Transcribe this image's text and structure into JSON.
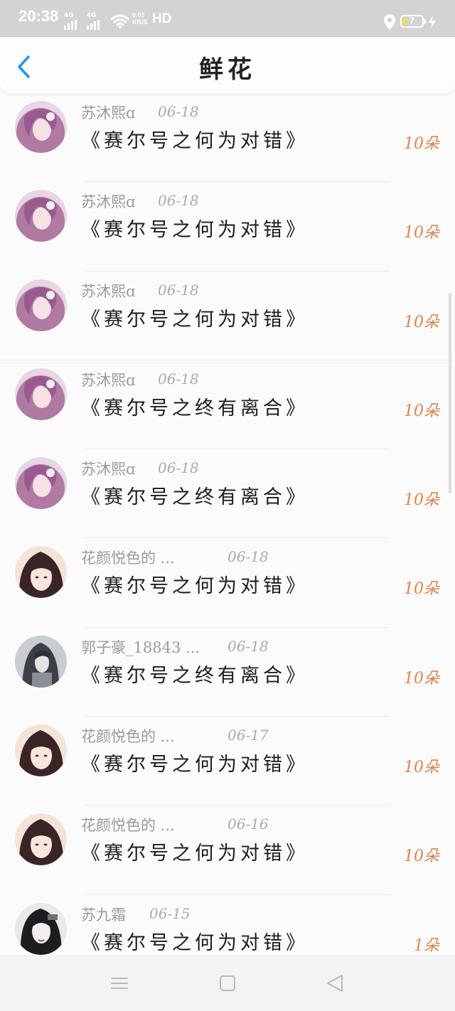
{
  "status_bar": {
    "time": "20:38",
    "network_labels": [
      "4G",
      "4G"
    ],
    "net_speed_value": "0.03",
    "net_speed_unit": "KB/S",
    "hd_label": "HD",
    "battery_level": "7",
    "battery_fill_fraction": 0.07,
    "icons": [
      "signal-icon",
      "signal-icon",
      "wifi-icon",
      "location-icon",
      "battery-icon",
      "charging-icon"
    ]
  },
  "header": {
    "title": "鲜花",
    "back_icon": "chevron-left-icon"
  },
  "colors": {
    "accent_blue": "#2196e8",
    "count_orange": "#e2834b",
    "status_bar_bg": "#d3d3d5"
  },
  "gifts": [
    {
      "user": "苏沐熙ɑ",
      "date": "06-18",
      "work": "《赛尔号之何为对错》",
      "count": "10朵",
      "avatar": "pink-hair-girl"
    },
    {
      "user": "苏沐熙ɑ",
      "date": "06-18",
      "work": "《赛尔号之何为对错》",
      "count": "10朵",
      "avatar": "pink-hair-girl"
    },
    {
      "user": "苏沐熙ɑ",
      "date": "06-18",
      "work": "《赛尔号之何为对错》",
      "count": "10朵",
      "avatar": "pink-hair-girl"
    },
    {
      "user": "苏沐熙ɑ",
      "date": "06-18",
      "work": "《赛尔号之终有离合》",
      "count": "10朵",
      "avatar": "pink-hair-girl"
    },
    {
      "user": "苏沐熙ɑ",
      "date": "06-18",
      "work": "《赛尔号之终有离合》",
      "count": "10朵",
      "avatar": "pink-hair-girl"
    },
    {
      "user": "花颜悦色的 ...",
      "date": "06-18",
      "work": "《赛尔号之何为对错》",
      "count": "10朵",
      "avatar": "dark-hair-girl"
    },
    {
      "user": "郭子豪_18843 ...",
      "date": "06-18",
      "work": "《赛尔号之终有离合》",
      "count": "10朵",
      "avatar": "grey-hooded-figure"
    },
    {
      "user": "花颜悦色的 ...",
      "date": "06-17",
      "work": "《赛尔号之何为对错》",
      "count": "10朵",
      "avatar": "dark-hair-girl"
    },
    {
      "user": "花颜悦色的 ...",
      "date": "06-16",
      "work": "《赛尔号之何为对错》",
      "count": "10朵",
      "avatar": "dark-hair-girl"
    },
    {
      "user": "苏九霜",
      "date": "06-15",
      "work": "《赛尔号之何为对错》",
      "count": "1朵",
      "avatar": "black-hair-girl"
    }
  ],
  "nav_bar": {
    "icons": [
      "menu-icon",
      "home-icon",
      "back-triangle-icon"
    ]
  }
}
